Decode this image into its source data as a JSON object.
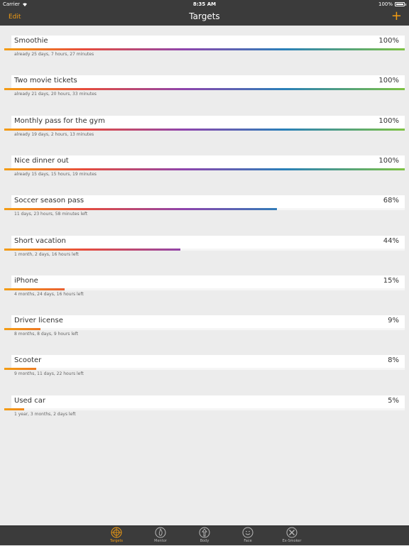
{
  "status": {
    "carrier": "Carrier",
    "time": "8:35 AM",
    "battery": "100%"
  },
  "nav": {
    "edit": "Edit",
    "title": "Targets",
    "add": "+"
  },
  "colors": {
    "accent": "#f39c12",
    "bar": "#3b3b3b"
  },
  "targets": [
    {
      "name": "Smoothie",
      "percent": "100%",
      "progress": 1.0,
      "meta": "already 25 days, 7 hours, 27 minutes"
    },
    {
      "name": "Two movie tickets",
      "percent": "100%",
      "progress": 1.0,
      "meta": "already 21 days, 20 hours, 33 minutes"
    },
    {
      "name": "Monthly pass for the gym",
      "percent": "100%",
      "progress": 1.0,
      "meta": "already 19 days, 2 hours, 13 minutes"
    },
    {
      "name": "Nice dinner out",
      "percent": "100%",
      "progress": 1.0,
      "meta": "already 15 days, 15 hours, 19 minutes"
    },
    {
      "name": "Soccer season pass",
      "percent": "68%",
      "progress": 0.68,
      "meta": "11 days, 23 hours, 58 minutes left"
    },
    {
      "name": "Short vacation",
      "percent": "44%",
      "progress": 0.44,
      "meta": "1 month, 2 days, 16 hours left"
    },
    {
      "name": "iPhone",
      "percent": "15%",
      "progress": 0.15,
      "meta": "4 months, 24 days, 16 hours left"
    },
    {
      "name": "Driver license",
      "percent": "9%",
      "progress": 0.09,
      "meta": "8 months, 8 days, 9 hours left"
    },
    {
      "name": "Scooter",
      "percent": "8%",
      "progress": 0.08,
      "meta": "9 months, 11 days, 22 hours left"
    },
    {
      "name": "Used car",
      "percent": "5%",
      "progress": 0.05,
      "meta": "1 year, 3 months, 2 days left"
    }
  ],
  "tabs": [
    {
      "label": "Targets",
      "icon": "target-icon",
      "active": true
    },
    {
      "label": "Mentor",
      "icon": "flame-icon",
      "active": false
    },
    {
      "label": "Body",
      "icon": "body-icon",
      "active": false
    },
    {
      "label": "Face",
      "icon": "face-icon",
      "active": false
    },
    {
      "label": "Ex-Smoker",
      "icon": "tools-icon",
      "active": false
    }
  ]
}
